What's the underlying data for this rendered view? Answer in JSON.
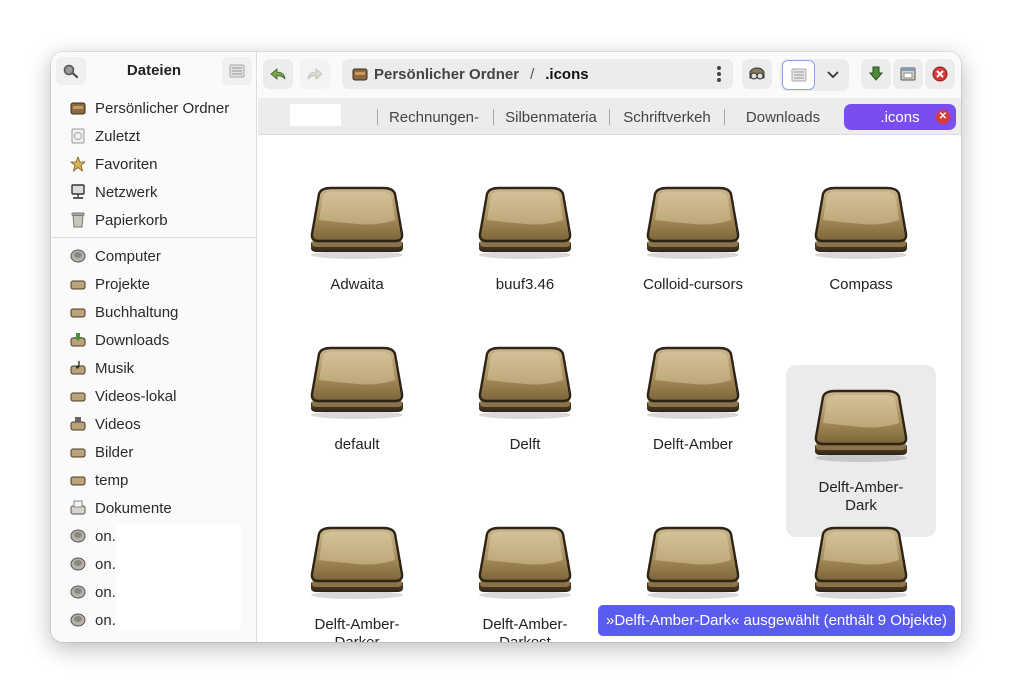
{
  "sidebar": {
    "title": "Dateien",
    "places": [
      {
        "label": "Persönlicher Ordner",
        "icon": "home-folder-icon"
      },
      {
        "label": "Zuletzt",
        "icon": "recent-icon"
      },
      {
        "label": "Favoriten",
        "icon": "star-icon"
      },
      {
        "label": "Netzwerk",
        "icon": "network-icon"
      },
      {
        "label": "Papierkorb",
        "icon": "trash-icon"
      }
    ],
    "drives": [
      {
        "label": "Computer",
        "icon": "drive-icon"
      },
      {
        "label": "Projekte",
        "icon": "folder-icon"
      },
      {
        "label": "Buchhaltung",
        "icon": "folder-icon"
      },
      {
        "label": "Downloads",
        "icon": "downloads-folder-icon"
      },
      {
        "label": "Musik",
        "icon": "music-folder-icon"
      },
      {
        "label": "Videos-lokal",
        "icon": "folder-icon"
      },
      {
        "label": "Videos",
        "icon": "videos-folder-icon"
      },
      {
        "label": "Bilder",
        "icon": "folder-icon"
      },
      {
        "label": "temp",
        "icon": "folder-icon"
      },
      {
        "label": "Dokumente",
        "icon": "documents-folder-icon"
      },
      {
        "label": "on.",
        "icon": "drive-icon"
      },
      {
        "label": "on.",
        "icon": "drive-icon"
      },
      {
        "label": "on.",
        "icon": "drive-icon"
      },
      {
        "label": "on.",
        "icon": "drive-icon"
      }
    ]
  },
  "toolbar": {
    "path_home": "Persönlicher Ordner",
    "path_separator": "/",
    "path_current": ".icons"
  },
  "tabs": [
    {
      "label": ""
    },
    {
      "label": "Rechnungen-"
    },
    {
      "label": "Silbenmateria"
    },
    {
      "label": "Schriftverkeh"
    },
    {
      "label": "Downloads"
    },
    {
      "label": ".icons",
      "active": true
    }
  ],
  "folders": [
    {
      "label": "Adwaita"
    },
    {
      "label": "buuf3.46"
    },
    {
      "label": "Colloid-cursors"
    },
    {
      "label": "Compass"
    },
    {
      "label": "default"
    },
    {
      "label": "Delft"
    },
    {
      "label": "Delft-Amber"
    },
    {
      "label": "Delft-Amber-Dark",
      "selected": true
    },
    {
      "label": "Delft-Amber-Darker"
    },
    {
      "label": "Delft-Amber-Darkest"
    },
    {
      "label": ""
    },
    {
      "label": ""
    }
  ],
  "status": {
    "text": "»Delft-Amber-Dark« ausgewählt  (enthält 9 Objekte)"
  },
  "colors": {
    "active_tab": "#7a4df0",
    "status_bar": "#5a5cf0",
    "close": "#d83a3a"
  }
}
